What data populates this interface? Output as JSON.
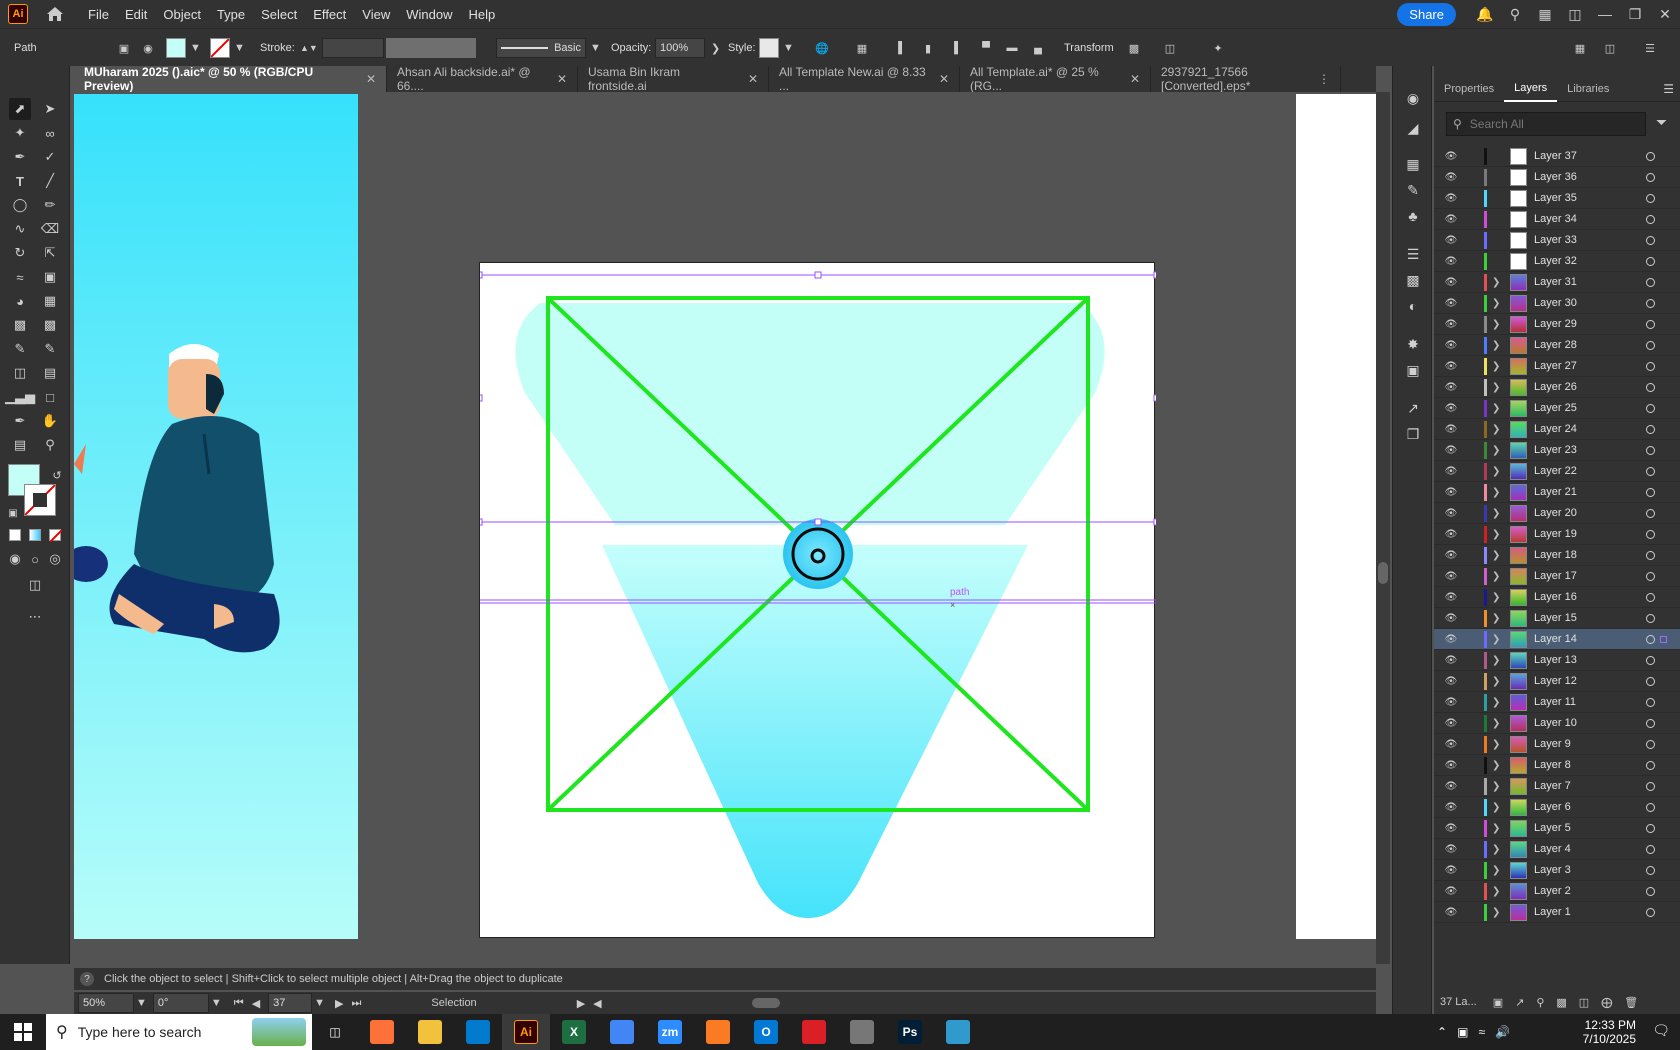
{
  "app": {
    "logo": "Ai",
    "menu": [
      "File",
      "Edit",
      "Object",
      "Type",
      "Select",
      "Effect",
      "View",
      "Window",
      "Help"
    ],
    "share_label": "Share"
  },
  "controlbar": {
    "object_type": "Path",
    "stroke_label": "Stroke:",
    "brush_label": "Basic",
    "opacity_label": "Opacity:",
    "opacity_value": "100%",
    "style_label": "Style:",
    "transform_label": "Transform"
  },
  "tabs": [
    {
      "label": "MUharam 2025 ().aic* @ 50 % (RGB/CPU Preview)",
      "active": true
    },
    {
      "label": "Ahsan Ali backside.ai* @ 66....",
      "active": false
    },
    {
      "label": "Usama Bin Ikram frontside.ai",
      "active": false
    },
    {
      "label": "All Template New.ai @ 8.33 ...",
      "active": false
    },
    {
      "label": "All Template.ai* @ 25 % (RG...",
      "active": false
    },
    {
      "label": "2937921_17566 [Converted].eps*",
      "active": false
    }
  ],
  "canvas": {
    "hover_label": "path",
    "colors": {
      "fill": "#c4fff7",
      "guide_green": "#1ee61e",
      "selection": "#9b4dff",
      "gradient_top": "#c4fffb",
      "gradient_bottom": "#45e3fb"
    }
  },
  "status": {
    "hint": "Click the object to select  |  Shift+Click to select multiple object  |  Alt+Drag the object to duplicate",
    "zoom": "50%",
    "rotation": "0°",
    "artboard_number": "37",
    "tool_name": "Selection"
  },
  "panel": {
    "tabs": [
      "Properties",
      "Layers",
      "Libraries"
    ],
    "active_tab": "Layers",
    "search_placeholder": "Search All",
    "footer_label": "37 La...",
    "layers": [
      {
        "name": "Layer 37",
        "color": "#111111",
        "sub": false
      },
      {
        "name": "Layer 36",
        "color": "#7a7a7a",
        "sub": false
      },
      {
        "name": "Layer 35",
        "color": "#4fd7ff",
        "sub": false
      },
      {
        "name": "Layer 34",
        "color": "#d14cd9",
        "sub": false
      },
      {
        "name": "Layer 33",
        "color": "#6b6bff",
        "sub": false
      },
      {
        "name": "Layer 32",
        "color": "#3cd13c",
        "sub": false
      },
      {
        "name": "Layer 31",
        "color": "#e25050",
        "sub": true
      },
      {
        "name": "Layer 30",
        "color": "#3cd13c",
        "sub": true
      },
      {
        "name": "Layer 29",
        "color": "#8a8a8a",
        "sub": true
      },
      {
        "name": "Layer 28",
        "color": "#4c7cff",
        "sub": true
      },
      {
        "name": "Layer 27",
        "color": "#f0e060",
        "sub": true
      },
      {
        "name": "Layer 26",
        "color": "#c0c0c0",
        "sub": true
      },
      {
        "name": "Layer 25",
        "color": "#7a35c8",
        "sub": true
      },
      {
        "name": "Layer 24",
        "color": "#8a6a20",
        "sub": true
      },
      {
        "name": "Layer 23",
        "color": "#3a8a3a",
        "sub": true
      },
      {
        "name": "Layer 22",
        "color": "#b03a5a",
        "sub": true
      },
      {
        "name": "Layer 21",
        "color": "#f08aa0",
        "sub": true
      },
      {
        "name": "Layer 20",
        "color": "#3a3ab0",
        "sub": true
      },
      {
        "name": "Layer 19",
        "color": "#d02020",
        "sub": true
      },
      {
        "name": "Layer 18",
        "color": "#8a8aff",
        "sub": true
      },
      {
        "name": "Layer 17",
        "color": "#d060d0",
        "sub": true
      },
      {
        "name": "Layer 16",
        "color": "#1a1a90",
        "sub": true
      },
      {
        "name": "Layer 15",
        "color": "#f0902a",
        "sub": true
      },
      {
        "name": "Layer 14",
        "color": "#6a6aff",
        "sub": true
      },
      {
        "name": "Layer 13",
        "color": "#b05a8a",
        "sub": true
      },
      {
        "name": "Layer 12",
        "color": "#d0a060",
        "sub": true
      },
      {
        "name": "Layer 11",
        "color": "#2aa0a0",
        "sub": true
      },
      {
        "name": "Layer 10",
        "color": "#1a7a3a",
        "sub": true
      },
      {
        "name": "Layer 9",
        "color": "#f07a20",
        "sub": true
      },
      {
        "name": "Layer 8",
        "color": "#111111",
        "sub": true
      },
      {
        "name": "Layer 7",
        "color": "#aaaaaa",
        "sub": true
      },
      {
        "name": "Layer 6",
        "color": "#4fd7ff",
        "sub": true
      },
      {
        "name": "Layer 5",
        "color": "#d14cd9",
        "sub": true
      },
      {
        "name": "Layer 4",
        "color": "#6b6bff",
        "sub": true
      },
      {
        "name": "Layer 3",
        "color": "#3cd13c",
        "sub": true
      },
      {
        "name": "Layer 2",
        "color": "#e25050",
        "sub": true
      },
      {
        "name": "Layer 1",
        "color": "#3cd13c",
        "sub": true
      }
    ],
    "selected_layer": "Layer 14"
  },
  "taskbar": {
    "search_placeholder": "Type here to search",
    "time": "12:33 PM",
    "date": "7/10/2025",
    "apps": [
      {
        "name": "firefox",
        "label": "",
        "color": "#ff7139"
      },
      {
        "name": "file-explorer",
        "label": "",
        "color": "#f3c23c"
      },
      {
        "name": "vscode",
        "label": "",
        "color": "#007acc"
      },
      {
        "name": "illustrator",
        "label": "Ai",
        "color": "#330000"
      },
      {
        "name": "excel",
        "label": "X",
        "color": "#1d6f42"
      },
      {
        "name": "chrome",
        "label": "",
        "color": "#4285f4"
      },
      {
        "name": "zoom",
        "label": "zm",
        "color": "#2d8cff"
      },
      {
        "name": "xampp",
        "label": "",
        "color": "#fb7a24"
      },
      {
        "name": "outlook",
        "label": "O",
        "color": "#0078d4"
      },
      {
        "name": "creative-cloud",
        "label": "",
        "color": "#da1f26"
      },
      {
        "name": "pen-tool-app",
        "label": "",
        "color": "#777777"
      },
      {
        "name": "photoshop",
        "label": "Ps",
        "color": "#001e36"
      },
      {
        "name": "misc-app",
        "label": "",
        "color": "#2f9acb"
      }
    ]
  }
}
